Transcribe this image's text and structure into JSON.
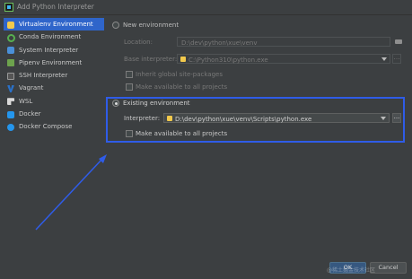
{
  "window": {
    "title": "Add Python Interpreter"
  },
  "sidebar": {
    "items": [
      {
        "label": "Virtualenv Environment",
        "icon": "virtualenv-icon",
        "selected": true
      },
      {
        "label": "Conda Environment",
        "icon": "conda-icon"
      },
      {
        "label": "System Interpreter",
        "icon": "python-icon"
      },
      {
        "label": "Pipenv Environment",
        "icon": "pipenv-icon"
      },
      {
        "label": "SSH Interpreter",
        "icon": "ssh-icon"
      },
      {
        "label": "Vagrant",
        "icon": "vagrant-icon"
      },
      {
        "label": "WSL",
        "icon": "wsl-icon"
      },
      {
        "label": "Docker",
        "icon": "docker-icon"
      },
      {
        "label": "Docker Compose",
        "icon": "docker-compose-icon"
      }
    ]
  },
  "new_env": {
    "radio_label": "New environment",
    "location_label": "Location:",
    "location_value": "D:\\dev\\python\\xue\\venv",
    "base_label": "Base interpreter:",
    "base_value": "C:\\Python310\\python.exe",
    "inherit_label": "Inherit global site-packages",
    "make_available_label": "Make available to all projects"
  },
  "existing_env": {
    "radio_label": "Existing environment",
    "selected": true,
    "interpreter_label": "Interpreter:",
    "interpreter_value": "D:\\dev\\python\\xue\\venv\\Scripts\\python.exe",
    "browse_label": "...",
    "make_available_label": "Make available to all projects"
  },
  "footer": {
    "ok_label": "OK",
    "cancel_label": "Cancel",
    "watermark": "@稀土掘金技术社区"
  },
  "colors": {
    "accent": "#2f65ca",
    "annotation": "#2f5ce8"
  }
}
